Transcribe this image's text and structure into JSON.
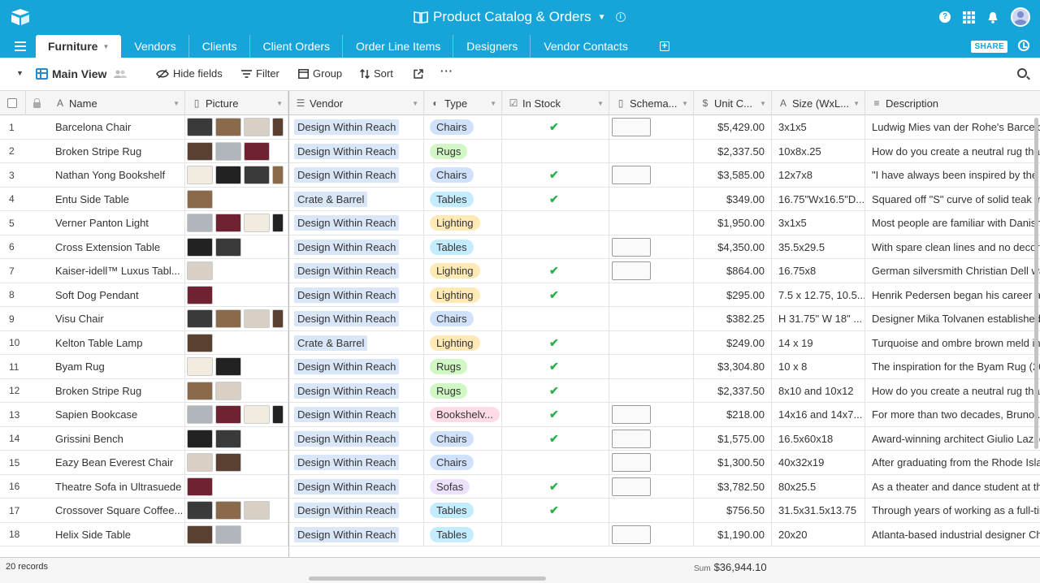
{
  "app": {
    "base_title": "Product Catalog & Orders",
    "colors": {
      "brand": "#17a4d8",
      "check": "#2bb24c",
      "vendor_pill": "#d8e6f8"
    }
  },
  "tabs": [
    {
      "label": "Furniture",
      "active": true
    },
    {
      "label": "Vendors"
    },
    {
      "label": "Clients"
    },
    {
      "label": "Client Orders"
    },
    {
      "label": "Order Line Items"
    },
    {
      "label": "Designers"
    },
    {
      "label": "Vendor Contacts"
    }
  ],
  "share_label": "SHARE",
  "toolbar": {
    "view_name": "Main View",
    "hide_fields": "Hide fields",
    "filter": "Filter",
    "group": "Group",
    "sort": "Sort",
    "more": "···"
  },
  "columns": {
    "name": "Name",
    "picture": "Picture",
    "vendor": "Vendor",
    "type": "Type",
    "in_stock": "In Stock",
    "schematic": "Schema...",
    "unit_cost": "Unit C...",
    "size": "Size (WxL...",
    "description": "Description"
  },
  "type_colors": {
    "Chairs": "#d0e2fb",
    "Rugs": "#d1f7c4",
    "Tables": "#c4ecff",
    "Lighting": "#ffeab6",
    "Bookshelv...": "#ffdce5",
    "Sofas": "#ede2fe"
  },
  "rows": [
    {
      "n": "1",
      "name": "Barcelona Chair",
      "vendor": "Design Within Reach",
      "type": "Chairs",
      "stock": true,
      "schem": 1,
      "cost": "$5,429.00",
      "size": "3x1x5",
      "desc": "Ludwig Mies van der Rohe's Barcelona",
      "pics": 4
    },
    {
      "n": "2",
      "name": "Broken Stripe Rug",
      "vendor": "Design Within Reach",
      "type": "Rugs",
      "stock": false,
      "schem": 0,
      "cost": "$2,337.50",
      "size": "10x8x.25",
      "desc": "How do you create a neutral rug that",
      "pics": 3
    },
    {
      "n": "3",
      "name": "Nathan Yong Bookshelf",
      "vendor": "Design Within Reach",
      "type": "Chairs",
      "stock": true,
      "schem": 1,
      "cost": "$3,585.00",
      "size": "12x7x8",
      "desc": "\"I have always been inspired by the ...",
      "pics": 4
    },
    {
      "n": "4",
      "name": "Entu Side Table",
      "vendor": "Crate & Barrel",
      "type": "Tables",
      "stock": true,
      "schem": 0,
      "cost": "$349.00",
      "size": "16.75\"Wx16.5\"D...",
      "desc": "Squared off \"S\" curve of solid teak in",
      "pics": 1
    },
    {
      "n": "5",
      "name": "Verner Panton Light",
      "vendor": "Design Within Reach",
      "type": "Lighting",
      "stock": false,
      "schem": 0,
      "cost": "$1,950.00",
      "size": "3x1x5",
      "desc": "Most people are familiar with Danish",
      "pics": 4
    },
    {
      "n": "6",
      "name": "Cross Extension Table",
      "vendor": "Design Within Reach",
      "type": "Tables",
      "stock": false,
      "schem": 1,
      "cost": "$4,350.00",
      "size": "35.5x29.5",
      "desc": "With spare clean lines and no decora",
      "pics": 2
    },
    {
      "n": "7",
      "name": "Kaiser-idell™ Luxus Tabl...",
      "vendor": "Design Within Reach",
      "type": "Lighting",
      "stock": true,
      "schem": 1,
      "cost": "$864.00",
      "size": "16.75x8",
      "desc": "German silversmith Christian Dell wa",
      "pics": 1
    },
    {
      "n": "8",
      "name": "Soft Dog Pendant",
      "vendor": "Design Within Reach",
      "type": "Lighting",
      "stock": true,
      "schem": 0,
      "cost": "$295.00",
      "size": "7.5 x 12.75, 10.5...",
      "desc": "Henrik Pedersen began his career as",
      "pics": 1
    },
    {
      "n": "9",
      "name": "Visu Chair",
      "vendor": "Design Within Reach",
      "type": "Chairs",
      "stock": false,
      "schem": 0,
      "cost": "$382.25",
      "size": "H 31.75\" W 18\" ...",
      "desc": "Designer Mika Tolvanen established h",
      "pics": 4
    },
    {
      "n": "10",
      "name": "Kelton Table Lamp",
      "vendor": "Crate & Barrel",
      "type": "Lighting",
      "stock": true,
      "schem": 0,
      "cost": "$249.00",
      "size": "14 x 19",
      "desc": "Turquoise and ombre brown meld in ...",
      "pics": 1
    },
    {
      "n": "11",
      "name": "Byam Rug",
      "vendor": "Design Within Reach",
      "type": "Rugs",
      "stock": true,
      "schem": 0,
      "cost": "$3,304.80",
      "size": "10 x 8",
      "desc": "The inspiration for the Byam Rug (20",
      "pics": 2
    },
    {
      "n": "12",
      "name": "Broken Stripe Rug",
      "vendor": "Design Within Reach",
      "type": "Rugs",
      "stock": true,
      "schem": 0,
      "cost": "$2,337.50",
      "size": "8x10 and 10x12",
      "desc": "How do you create a neutral rug that",
      "pics": 2
    },
    {
      "n": "13",
      "name": "Sapien Bookcase",
      "vendor": "Design Within Reach",
      "type": "Bookshelv...",
      "stock": true,
      "schem": 1,
      "cost": "$218.00",
      "size": "14x16 and 14x7...",
      "desc": "For more than two decades, Bruno ...",
      "pics": 4
    },
    {
      "n": "14",
      "name": "Grissini Bench",
      "vendor": "Design Within Reach",
      "type": "Chairs",
      "stock": true,
      "schem": 1,
      "cost": "$1,575.00",
      "size": "16.5x60x18",
      "desc": "Award-winning architect Giulio Lazzo",
      "pics": 2
    },
    {
      "n": "15",
      "name": "Eazy Bean Everest Chair",
      "vendor": "Design Within Reach",
      "type": "Chairs",
      "stock": false,
      "schem": 1,
      "cost": "$1,300.50",
      "size": "40x32x19",
      "desc": "After graduating from the Rhode Islan",
      "pics": 2
    },
    {
      "n": "16",
      "name": "Theatre Sofa in Ultrasuede",
      "vendor": "Design Within Reach",
      "type": "Sofas",
      "stock": true,
      "schem": 1,
      "cost": "$3,782.50",
      "size": "80x25.5",
      "desc": "As a theater and dance student at th",
      "pics": 1
    },
    {
      "n": "17",
      "name": "Crossover Square Coffee...",
      "vendor": "Design Within Reach",
      "type": "Tables",
      "stock": true,
      "schem": 0,
      "cost": "$756.50",
      "size": "31.5x31.5x13.75",
      "desc": "Through years of working as a full-tim",
      "pics": 3
    },
    {
      "n": "18",
      "name": "Helix Side Table",
      "vendor": "Design Within Reach",
      "type": "Tables",
      "stock": false,
      "schem": 1,
      "cost": "$1,190.00",
      "size": "20x20",
      "desc": "Atlanta-based industrial designer Ch",
      "pics": 2
    }
  ],
  "footer": {
    "records": "20 records",
    "sum_label": "Sum",
    "sum_value": "$36,944.10"
  }
}
